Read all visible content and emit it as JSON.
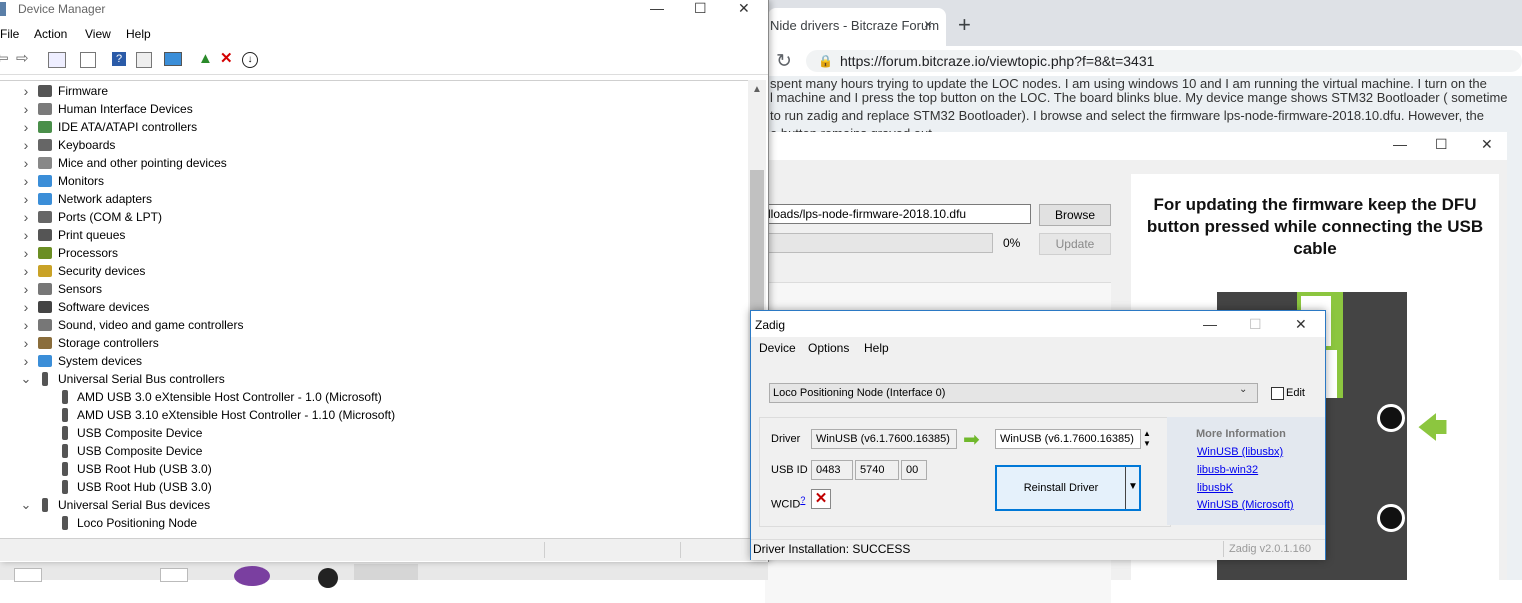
{
  "browser": {
    "tab_title": "Nide drivers - Bitcraze Forum",
    "tab_close": "×",
    "new_tab": "+",
    "reload": "↻",
    "lock": "🔒",
    "url": "https://forum.bitcraze.io/viewtopic.php?f=8&t=3431",
    "post_lines": [
      "spent many hours trying to update the LOC nodes. I am using windows 10 and I am running the virtual machine. I turn on the",
      "l machine and I press the top button on the LOC. The board blinks blue. My device mange shows STM32 Bootloader ( sometime",
      "to run zadig and replace STM32 Bootloader). I browse and select the firmware lps-node-firmware-2018.10.dfu. However, the",
      "e button remains grayed out."
    ]
  },
  "helper": {
    "minimize": "—",
    "maximize": "☐",
    "close": "✕",
    "path_value": "lloads/lps-node-firmware-2018.10.dfu",
    "browse_label": "Browse",
    "progress_text": "0%",
    "progress": 0,
    "update_label": "Update",
    "instructions": "For updating the firmware keep the DFU button pressed while connecting the USB cable",
    "arrow": "🡄"
  },
  "device_manager": {
    "title": "Device Manager",
    "window_controls": {
      "minimize": "—",
      "maximize": "☐",
      "close": "✕"
    },
    "menu": [
      "File",
      "Action",
      "View",
      "Help"
    ],
    "toolbar_icons": [
      "back-icon",
      "forward-icon",
      "properties-icon",
      "show-hidden-icon",
      "help-icon",
      "details-icon",
      "monitor-icon",
      "update-driver-icon",
      "uninstall-icon",
      "download-icon"
    ],
    "tree": [
      {
        "label": "Firmware",
        "level": 0,
        "state": "collapsed",
        "icon": "firmware-icon",
        "color": "#555555"
      },
      {
        "label": "Human Interface Devices",
        "level": 0,
        "state": "collapsed",
        "icon": "hid-icon",
        "color": "#7a7a7a"
      },
      {
        "label": "IDE ATA/ATAPI controllers",
        "level": 0,
        "state": "collapsed",
        "icon": "ide-icon",
        "color": "#4a8f4a"
      },
      {
        "label": "Keyboards",
        "level": 0,
        "state": "collapsed",
        "icon": "keyboard-icon",
        "color": "#666666"
      },
      {
        "label": "Mice and other pointing devices",
        "level": 0,
        "state": "collapsed",
        "icon": "mouse-icon",
        "color": "#888888"
      },
      {
        "label": "Monitors",
        "level": 0,
        "state": "collapsed",
        "icon": "monitor-icon",
        "color": "#3b8ed8"
      },
      {
        "label": "Network adapters",
        "level": 0,
        "state": "collapsed",
        "icon": "network-icon",
        "color": "#3b8ed8"
      },
      {
        "label": "Ports (COM & LPT)",
        "level": 0,
        "state": "collapsed",
        "icon": "port-icon",
        "color": "#666666"
      },
      {
        "label": "Print queues",
        "level": 0,
        "state": "collapsed",
        "icon": "printer-icon",
        "color": "#555555"
      },
      {
        "label": "Processors",
        "level": 0,
        "state": "collapsed",
        "icon": "processor-icon",
        "color": "#6b8e23"
      },
      {
        "label": "Security devices",
        "level": 0,
        "state": "collapsed",
        "icon": "security-icon",
        "color": "#c9a227"
      },
      {
        "label": "Sensors",
        "level": 0,
        "state": "collapsed",
        "icon": "sensor-icon",
        "color": "#777777"
      },
      {
        "label": "Software devices",
        "level": 0,
        "state": "collapsed",
        "icon": "software-device-icon",
        "color": "#444444"
      },
      {
        "label": "Sound, video and game controllers",
        "level": 0,
        "state": "collapsed",
        "icon": "sound-icon",
        "color": "#777777"
      },
      {
        "label": "Storage controllers",
        "level": 0,
        "state": "collapsed",
        "icon": "storage-icon",
        "color": "#8a6d3b"
      },
      {
        "label": "System devices",
        "level": 0,
        "state": "collapsed",
        "icon": "system-icon",
        "color": "#3b8ed8"
      },
      {
        "label": "Universal Serial Bus controllers",
        "level": 0,
        "state": "expanded",
        "icon": "usb-icon",
        "color": "#555555"
      },
      {
        "label": "AMD USB 3.0 eXtensible Host Controller - 1.0 (Microsoft)",
        "level": 1,
        "state": "leaf",
        "icon": "usb-icon",
        "color": "#555555"
      },
      {
        "label": "AMD USB 3.10 eXtensible Host Controller - 1.10 (Microsoft)",
        "level": 1,
        "state": "leaf",
        "icon": "usb-icon",
        "color": "#555555"
      },
      {
        "label": "USB Composite Device",
        "level": 1,
        "state": "leaf",
        "icon": "usb-icon",
        "color": "#555555"
      },
      {
        "label": "USB Composite Device",
        "level": 1,
        "state": "leaf",
        "icon": "usb-icon",
        "color": "#555555"
      },
      {
        "label": "USB Root Hub (USB 3.0)",
        "level": 1,
        "state": "leaf",
        "icon": "usb-icon",
        "color": "#555555"
      },
      {
        "label": "USB Root Hub (USB 3.0)",
        "level": 1,
        "state": "leaf",
        "icon": "usb-icon",
        "color": "#555555"
      },
      {
        "label": "Universal Serial Bus devices",
        "level": 0,
        "state": "expanded",
        "icon": "usb-icon",
        "color": "#555555"
      },
      {
        "label": "Loco Positioning Node",
        "level": 1,
        "state": "leaf",
        "icon": "usb-icon",
        "color": "#555555"
      }
    ],
    "scroll_up": "▲"
  },
  "zadig": {
    "title": "Zadig",
    "window_controls": {
      "minimize": "—",
      "maximize": "☐",
      "close": "✕"
    },
    "menu": [
      "Device",
      "Options",
      "Help"
    ],
    "device_selected": "Loco Positioning Node (Interface 0)",
    "device_caret": "⌄",
    "edit_label": "Edit",
    "driver_label": "Driver",
    "current_driver": "WinUSB (v6.1.7600.16385)",
    "target_driver": "WinUSB (v6.1.7600.16385)",
    "driver_arrow": "➡",
    "usbid_label": "USB ID",
    "usb_id": [
      "0483",
      "5740",
      "00"
    ],
    "wcid_label": "WCID",
    "wcid_sup": "?",
    "wcid_value": "✕",
    "reinstall_label": "Reinstall Driver",
    "reinstall_caret": "▼",
    "more_info_title": "More Information",
    "links": [
      "WinUSB (libusbx)",
      "libusb-win32",
      "libusbK",
      "WinUSB (Microsoft)"
    ],
    "status": "Driver Installation: SUCCESS",
    "version": "Zadig v2.0.1.160"
  }
}
